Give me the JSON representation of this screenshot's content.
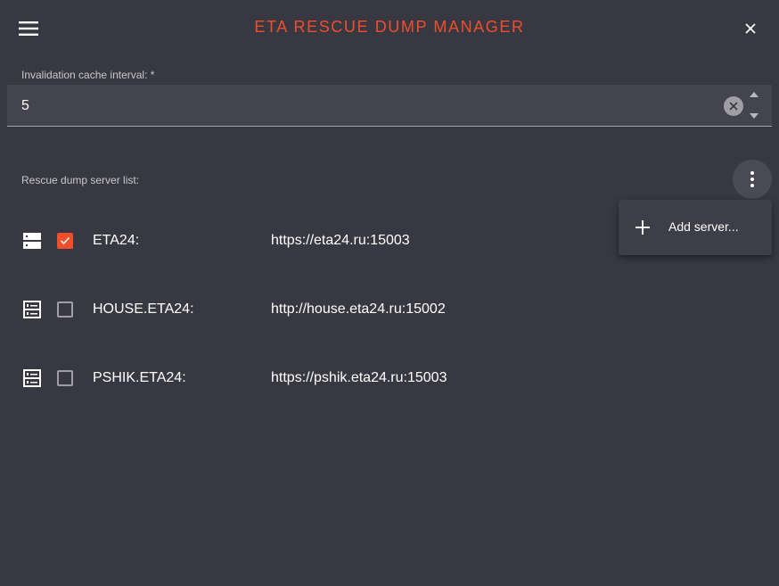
{
  "header": {
    "title": "ETA RESCUE DUMP MANAGER",
    "menu_icon": "hamburger-menu-icon",
    "close_icon": "close-icon",
    "accent_color": "#f04e2a"
  },
  "cache_field": {
    "label": "Invalidation cache interval: *",
    "value": "5"
  },
  "server_list": {
    "label": "Rescue dump server list:",
    "servers": [
      {
        "name": "ETA24:",
        "url": "https://eta24.ru:15003",
        "checked": true
      },
      {
        "name": "HOUSE.ETA24:",
        "url": "http://house.eta24.ru:15002",
        "checked": false
      },
      {
        "name": "PSHIK.ETA24:",
        "url": "https://pshik.eta24.ru:15003",
        "checked": false
      }
    ]
  },
  "menu": {
    "items": [
      {
        "label": "Add server...",
        "icon": "plus-icon"
      }
    ]
  }
}
